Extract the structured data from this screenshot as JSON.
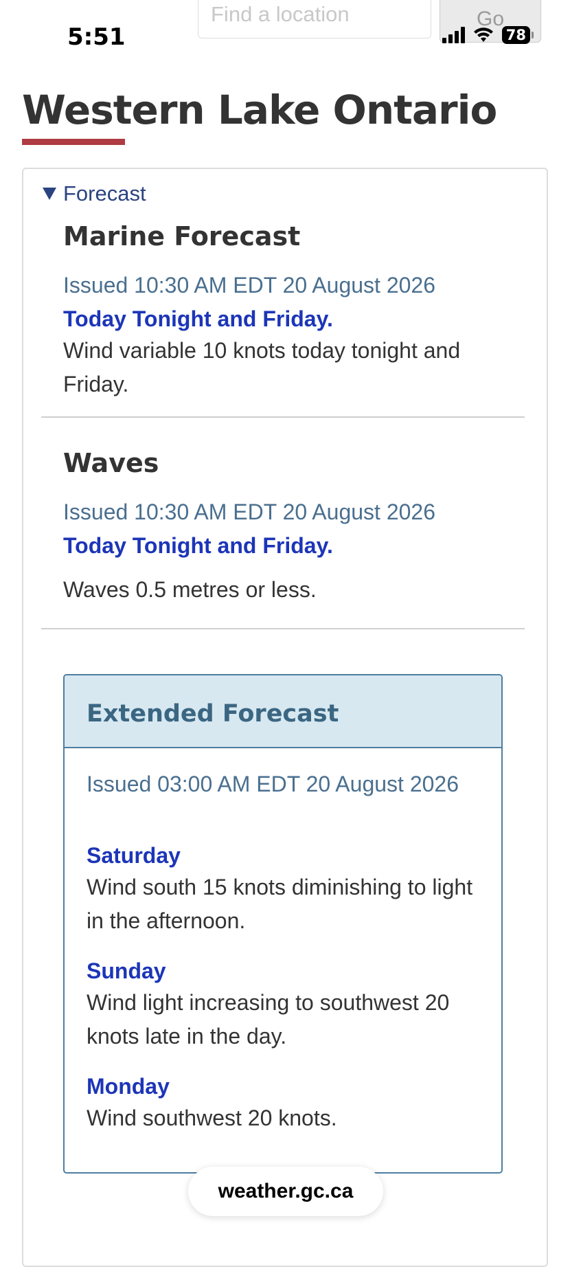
{
  "status_bar": {
    "time": "5:51",
    "battery": "78"
  },
  "search": {
    "placeholder": "Find a location",
    "go_label": "Go"
  },
  "page": {
    "title": "Western Lake Ontario"
  },
  "forecast": {
    "summary_label": "Forecast",
    "marine": {
      "heading": "Marine Forecast",
      "issued": "Issued 10:30 AM EDT 20 August 2026",
      "period": "Today Tonight and Friday.",
      "text": "Wind variable 10 knots today tonight and Friday."
    },
    "waves": {
      "heading": "Waves",
      "issued": "Issued 10:30 AM EDT 20 August 2026",
      "period": "Today Tonight and Friday.",
      "text": "Waves 0.5 metres or less."
    },
    "extended": {
      "heading": "Extended Forecast",
      "issued": "Issued 03:00 AM EDT 20 August 2026",
      "days": [
        {
          "day": "Saturday",
          "text": "Wind south 15 knots diminishing to light in the afternoon."
        },
        {
          "day": "Sunday",
          "text": "Wind light increasing to southwest 20 knots late in the day."
        },
        {
          "day": "Monday",
          "text": "Wind southwest 20 knots."
        }
      ]
    }
  },
  "footer": {
    "domain": "weather.gc.ca"
  },
  "colors": {
    "accent_red": "#af3c43",
    "link_blue": "#1c35b8",
    "issued_gray_blue": "#4a6f8f",
    "ext_header_bg": "#d7e8f1"
  }
}
